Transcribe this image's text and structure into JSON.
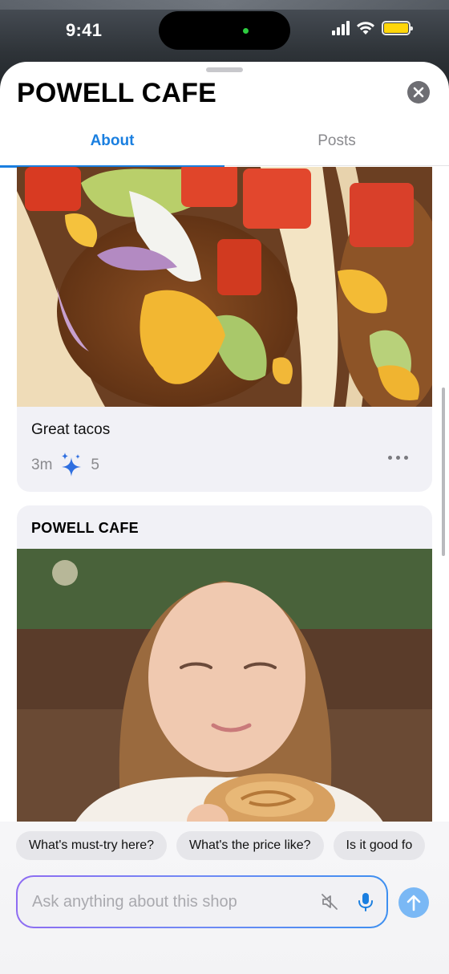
{
  "status_bar": {
    "time": "9:41"
  },
  "header": {
    "title": "POWELL CAFE"
  },
  "tabs": [
    {
      "label": "About",
      "active": true
    },
    {
      "label": "Posts",
      "active": false
    }
  ],
  "posts": [
    {
      "caption": "Great tacos",
      "age": "3m",
      "sparkle_count": "5",
      "image": "tacos photo"
    },
    {
      "author": "POWELL CAFE",
      "image": "girl holding cinnamon roll photo"
    }
  ],
  "suggestions": [
    "What's must-try here?",
    "What's the price like?",
    "Is it good fo"
  ],
  "ask": {
    "placeholder": "Ask anything about this shop",
    "value": ""
  },
  "colors": {
    "accent": "#1a7fe0",
    "send": "#7ab8f5",
    "battery": "#ffd60a"
  },
  "icons": [
    "close-icon",
    "sparkle-icon",
    "more-icon",
    "mute-icon",
    "mic-icon",
    "arrow-up-icon"
  ]
}
